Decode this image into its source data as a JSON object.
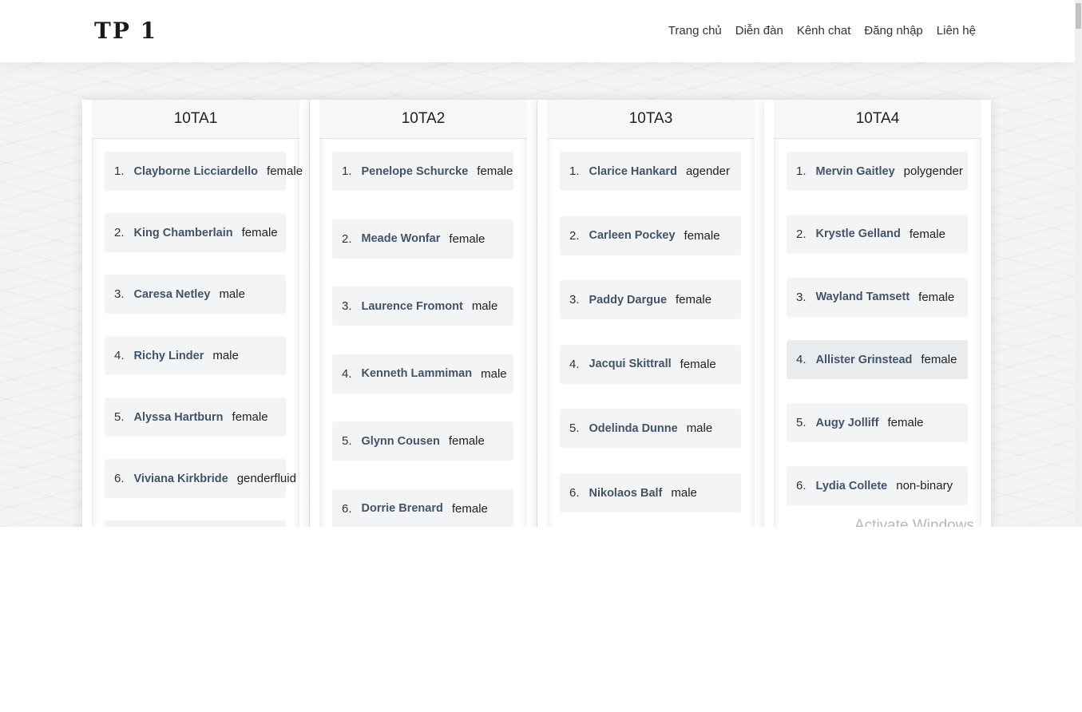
{
  "header": {
    "logo": "TP 1",
    "nav": [
      "Trang chủ",
      "Diễn đàn",
      "Kênh chat",
      "Đăng nhập",
      "Liên hệ"
    ]
  },
  "columns": [
    {
      "title": "10TA1",
      "items": [
        {
          "num": "1.",
          "name": "Clayborne Licciardello",
          "gender": "female"
        },
        {
          "num": "2.",
          "name": "King Chamberlain",
          "gender": "female"
        },
        {
          "num": "3.",
          "name": "Caresa Netley",
          "gender": "male"
        },
        {
          "num": "4.",
          "name": "Richy Linder",
          "gender": "male"
        },
        {
          "num": "5.",
          "name": "Alyssa Hartburn",
          "gender": "female"
        },
        {
          "num": "6.",
          "name": "Viviana Kirkbride",
          "gender": "genderfluid"
        },
        {
          "num": "",
          "name": "",
          "gender": ""
        }
      ]
    },
    {
      "title": "10TA2",
      "items": [
        {
          "num": "1.",
          "name": "Penelope Schurcke",
          "gender": "female"
        },
        {
          "num": "2.",
          "name": "Meade Wonfar",
          "gender": "female"
        },
        {
          "num": "3.",
          "name": "Laurence Fromont",
          "gender": "male"
        },
        {
          "num": "4.",
          "name": "Kenneth Lammiman",
          "gender": "male"
        },
        {
          "num": "5.",
          "name": "Glynn Cousen",
          "gender": "female"
        },
        {
          "num": "6.",
          "name": "Dorrie Brenard",
          "gender": "female"
        }
      ]
    },
    {
      "title": "10TA3",
      "items": [
        {
          "num": "1.",
          "name": "Clarice Hankard",
          "gender": "agender"
        },
        {
          "num": "2.",
          "name": "Carleen Pockey",
          "gender": "female"
        },
        {
          "num": "3.",
          "name": "Paddy Dargue",
          "gender": "female"
        },
        {
          "num": "4.",
          "name": "Jacqui Skittrall",
          "gender": "female"
        },
        {
          "num": "5.",
          "name": "Odelinda Dunne",
          "gender": "male"
        },
        {
          "num": "6.",
          "name": "Nikolaos Balf",
          "gender": "male"
        }
      ]
    },
    {
      "title": "10TA4",
      "items": [
        {
          "num": "1.",
          "name": "Mervin Gaitley",
          "gender": "polygender"
        },
        {
          "num": "2.",
          "name": "Krystle Gelland",
          "gender": "female"
        },
        {
          "num": "3.",
          "name": "Wayland Tamsett",
          "gender": "female"
        },
        {
          "num": "4.",
          "name": "Allister Grinstead",
          "gender": "female"
        },
        {
          "num": "5.",
          "name": "Augy Jolliff",
          "gender": "female"
        },
        {
          "num": "6.",
          "name": "Lydia Collete",
          "gender": "non-binary"
        }
      ]
    }
  ],
  "watermark": "Activate Windows"
}
